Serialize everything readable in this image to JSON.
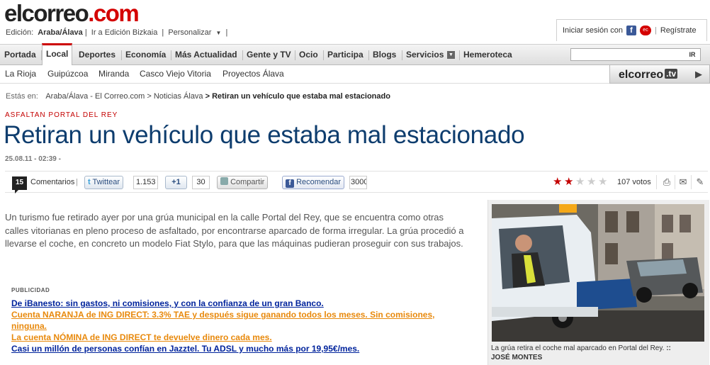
{
  "header": {
    "logo_main": "elcorreo",
    "logo_tld": ".com",
    "edition_label": "Edición:",
    "edition_current": "Araba/Álava",
    "edition_switch": "Ir a Edición Bizkaia",
    "personalize": "Personalizar",
    "login_label": "Iniciar sesión con",
    "register": "Regístrate"
  },
  "nav": {
    "items": [
      "Portada",
      "Local",
      "Deportes",
      "Economía",
      "Más Actualidad",
      "Gente y TV",
      "Ocio",
      "Participa",
      "Blogs",
      "Servicios",
      "Hemeroteca"
    ],
    "active": "Local",
    "search_button": "IR"
  },
  "subnav": {
    "items": [
      "La Rioja",
      "Guipúzcoa",
      "Miranda",
      "Casco Viejo Vitoria",
      "Proyectos Álava"
    ]
  },
  "tv": {
    "label": "elcorreo",
    "suffix": ".tv"
  },
  "breadcrumb": {
    "label": "Estás en:",
    "items": [
      "Araba/Álava - El Correo.com",
      "> Noticias Álava",
      "> Retiran un vehículo que estaba mal estacionado"
    ]
  },
  "article": {
    "kicker": "ASFALTAN PORTAL DEL REY",
    "title": "Retiran un vehículo que estaba mal estacionado",
    "date": "25.08.11 - 02:39 -",
    "body": "Un turismo fue retirado ayer por una grúa municipal en la calle Portal del Rey, que se encuentra como otras calles vitorianas en pleno proceso de asfaltado, por encontrarse aparcado de forma irregular. La grúa procedió a llevarse el coche, en concreto un modelo Fiat Stylo, para que las máquinas pudieran proseguir con sus trabajos."
  },
  "toolbar": {
    "comments_count": "15",
    "comments_label": "Comentarios",
    "separator": "|",
    "twitter_label": "Twittear",
    "twitter_count": "1.153",
    "plusone_label": "+1",
    "plusone_count": "30",
    "share_label": "Compartir",
    "facebook_label": "Recomendar",
    "facebook_count": "3000",
    "rating": 2,
    "rating_max": 5,
    "votes": "107 votos"
  },
  "advertising": {
    "label": "PUBLICIDAD",
    "ads": [
      {
        "text": "De iBanesto: sin gastos, ni comisiones, y con la confianza de un gran Banco.",
        "color": "#00239c"
      },
      {
        "text": "Cuenta NARANJA de ING DIRECT: 3.3% TAE y después sigue ganando todos los meses. Sin comisiones, ninguna.",
        "color": "#e8890c"
      },
      {
        "text": "La cuenta NÓMINA de ING DIRECT te devuelve dinero cada mes.",
        "color": "#e8890c"
      },
      {
        "text": "Casi un millón de personas confían en Jazztel. Tu ADSL y mucho más por 19,95€/mes.",
        "color": "#00239c"
      }
    ]
  },
  "photo": {
    "caption": "La grúa retira el coche mal aparcado en Portal del Rey.",
    "caption_mark": "::",
    "credit": "JOSÉ MONTES"
  },
  "colors": {
    "brand_red": "#d40000",
    "headline_blue": "#0e3d6e"
  }
}
